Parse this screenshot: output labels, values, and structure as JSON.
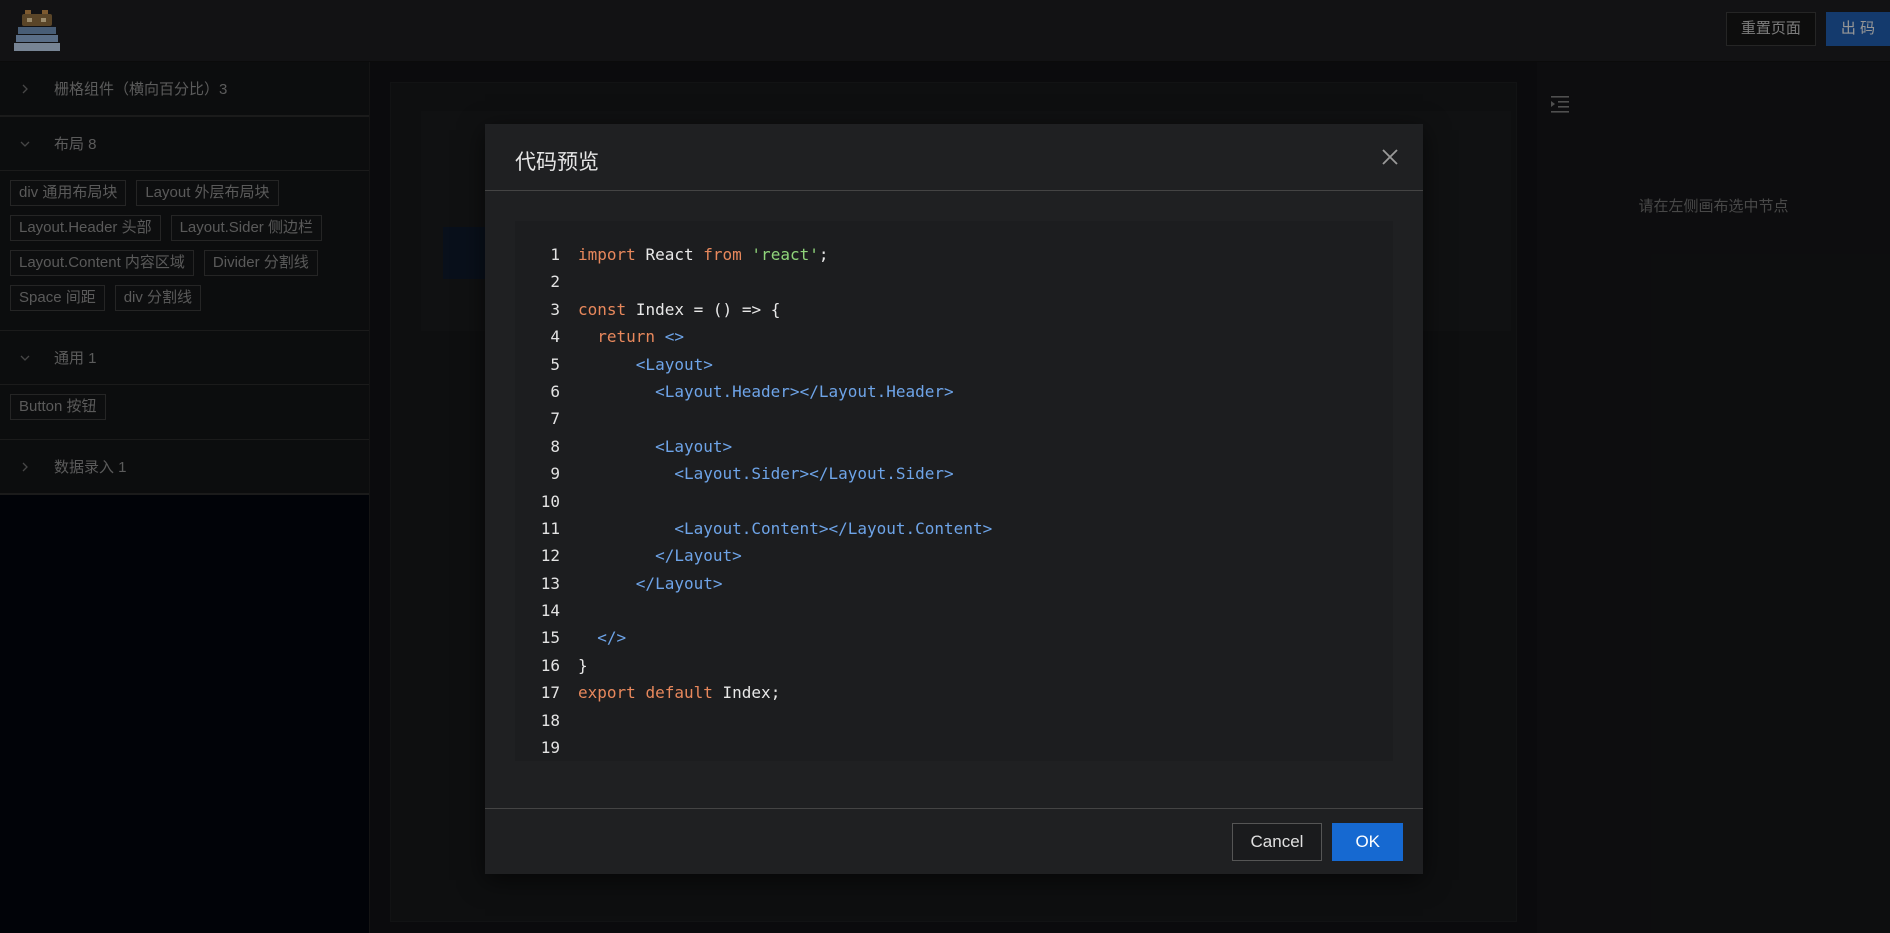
{
  "app": {
    "logo_icon": "robot-logo-icon"
  },
  "toolbar": {
    "reset_label": "重置页面",
    "export_label": "出 码"
  },
  "sidebar": {
    "panels": [
      {
        "title": "栅格组件（横向百分比）3",
        "expanded": false,
        "items": []
      },
      {
        "title": "布局 8",
        "expanded": true,
        "items": [
          "div 通用布局块",
          "Layout 外层布局块",
          "Layout.Header 头部",
          "Layout.Sider 侧边栏",
          "Layout.Content 内容区域",
          "Divider 分割线",
          "Space 间距",
          "div 分割线"
        ]
      },
      {
        "title": "通用 1",
        "expanded": true,
        "items": [
          "Button 按钮"
        ]
      },
      {
        "title": "数据录入 1",
        "expanded": false,
        "items": []
      }
    ]
  },
  "right_panel": {
    "hint": "请在左侧画布选中节点"
  },
  "modal": {
    "title": "代码预览",
    "cancel_label": "Cancel",
    "ok_label": "OK",
    "code_lines": [
      "import React from 'react';",
      "",
      "const Index = () => {",
      "  return <>",
      "      <Layout>",
      "        <Layout.Header></Layout.Header>",
      "",
      "        <Layout>",
      "          <Layout.Sider></Layout.Sider>",
      "",
      "          <Layout.Content></Layout.Content>",
      "        </Layout>",
      "      </Layout>",
      "",
      "  </>",
      "}",
      "export default Index;",
      "",
      ""
    ]
  },
  "colors": {
    "keyword": "#e8885c",
    "string": "#8fd47a",
    "tag": "#6ea4e8",
    "primary": "#1669d1"
  }
}
